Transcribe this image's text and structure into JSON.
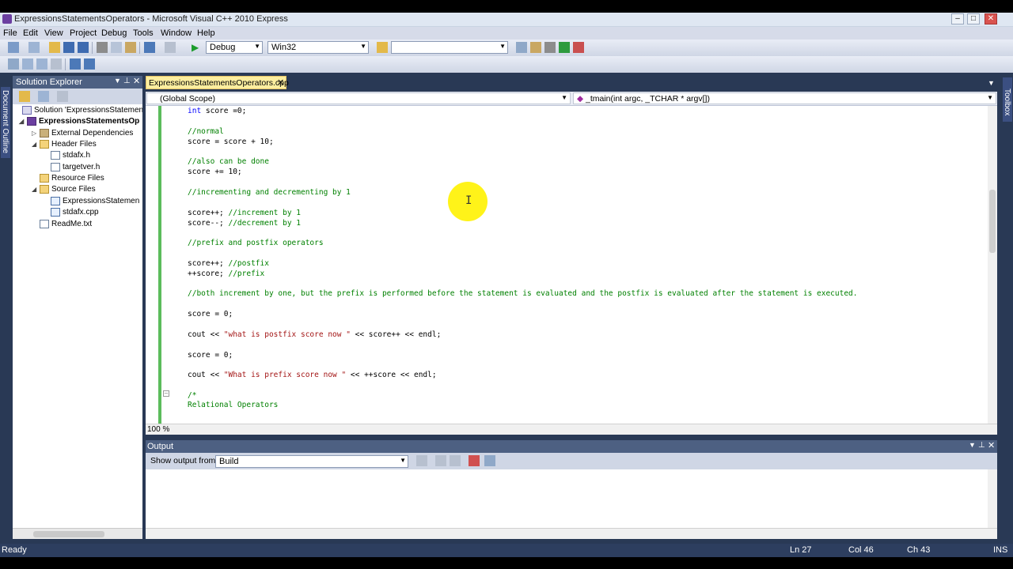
{
  "window": {
    "title": "ExpressionsStatementsOperators - Microsoft Visual C++ 2010 Express"
  },
  "menu": [
    "File",
    "Edit",
    "View",
    "Project",
    "Debug",
    "Tools",
    "Window",
    "Help"
  ],
  "toolbar": {
    "config": "Debug",
    "platform": "Win32",
    "find_value": ""
  },
  "solution_explorer": {
    "title": "Solution Explorer",
    "items": [
      {
        "label": "Solution 'ExpressionsStatement",
        "icon": "solution-icon"
      },
      {
        "label": "ExpressionsStatementsOp",
        "icon": "project-icon"
      },
      {
        "label": "External Dependencies",
        "icon": "dependencies-icon"
      },
      {
        "label": "Header Files",
        "icon": "folder-icon"
      },
      {
        "label": "stdafx.h",
        "icon": "header-file-icon"
      },
      {
        "label": "targetver.h",
        "icon": "header-file-icon"
      },
      {
        "label": "Resource Files",
        "icon": "folder-icon"
      },
      {
        "label": "Source Files",
        "icon": "folder-icon"
      },
      {
        "label": "ExpressionsStatemen",
        "icon": "cpp-file-icon"
      },
      {
        "label": "stdafx.cpp",
        "icon": "cpp-file-icon"
      },
      {
        "label": "ReadMe.txt",
        "icon": "text-file-icon"
      }
    ]
  },
  "side_tabs": {
    "left": "Document Outline",
    "right": "Toolbox"
  },
  "editor": {
    "tab_label": "ExpressionsStatementsOperators.cpp",
    "scope": "(Global Scope)",
    "member": "_tmain(int argc, _TCHAR * argv[])",
    "zoom": "100 %",
    "lines": {
      "l1_kw": "int",
      "l1_rest": " score =0;",
      "l2": "//normal",
      "l3": "score = score + 10;",
      "l4": "//also can be done",
      "l5": "score += 10;",
      "l6": "//incrementing and decrementing by 1",
      "l7_code": "score++; ",
      "l7_comment": "//increment by 1",
      "l8_code": "score--; ",
      "l8_comment": "//decrement by 1",
      "l9": "//prefix and postfix operators",
      "l10_code": "score++; ",
      "l10_comment": "//postfix",
      "l11_code": "++score; ",
      "l11_comment": "//prefix",
      "l12": "//both increment by one, but the prefix is performed before the statement is evaluated and the postfix is evaluated after the statement is executed.",
      "l13": "score = 0;",
      "l14_a": "cout << ",
      "l14_str": "\"what is postfix score now \"",
      "l14_b": " << score++ << endl;",
      "l15": "score = 0;",
      "l16_a": "cout << ",
      "l16_str": "\"What is prefix score now \"",
      "l16_b": " << ++score << endl;",
      "l17": "/*",
      "l18": "Relational Operators"
    }
  },
  "output": {
    "title": "Output",
    "show_from_label": "Show output from:",
    "source": "Build"
  },
  "status": {
    "ready": "Ready",
    "line": "Ln 27",
    "col": "Col 46",
    "ch": "Ch 43",
    "mode": "INS"
  }
}
